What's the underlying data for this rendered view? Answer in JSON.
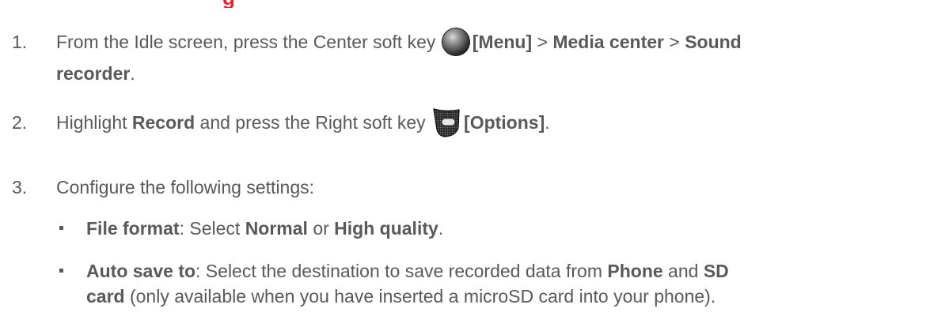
{
  "heading_fragment": "g",
  "steps": [
    {
      "number": "1.",
      "line1": {
        "t1": "From the Idle screen, press the Center soft key ",
        "b1": "[Menu]",
        "t2": " > ",
        "b2": "Media center",
        "t3": " > ",
        "b3": "Sound"
      },
      "line2": {
        "b1": "recorder",
        "t1": "."
      }
    },
    {
      "number": "2.",
      "t1": "Highlight ",
      "b1": "Record",
      "t2": " and press the Right soft key ",
      "b2": "[Options]",
      "t3": "."
    },
    {
      "number": "3.",
      "t1": "Configure the following settings:"
    }
  ],
  "bullets": [
    {
      "b1": "File format",
      "t1": ": Select ",
      "b2": "Normal",
      "t2": " or ",
      "b3": "High quality",
      "t3": "."
    },
    {
      "line1": {
        "b1": "Auto save to",
        "t1": ": Select the destination to save recorded data from ",
        "b2": "Phone",
        "t2": " and ",
        "b3": "SD"
      },
      "line2": {
        "b1": "card",
        "t1": " (only available when you have inserted a microSD card into your phone)."
      }
    }
  ],
  "icons": {
    "center_key": "center-soft-key-icon",
    "right_key": "right-soft-key-icon"
  },
  "colors": {
    "text": "#595959",
    "heading": "#e8202a"
  }
}
